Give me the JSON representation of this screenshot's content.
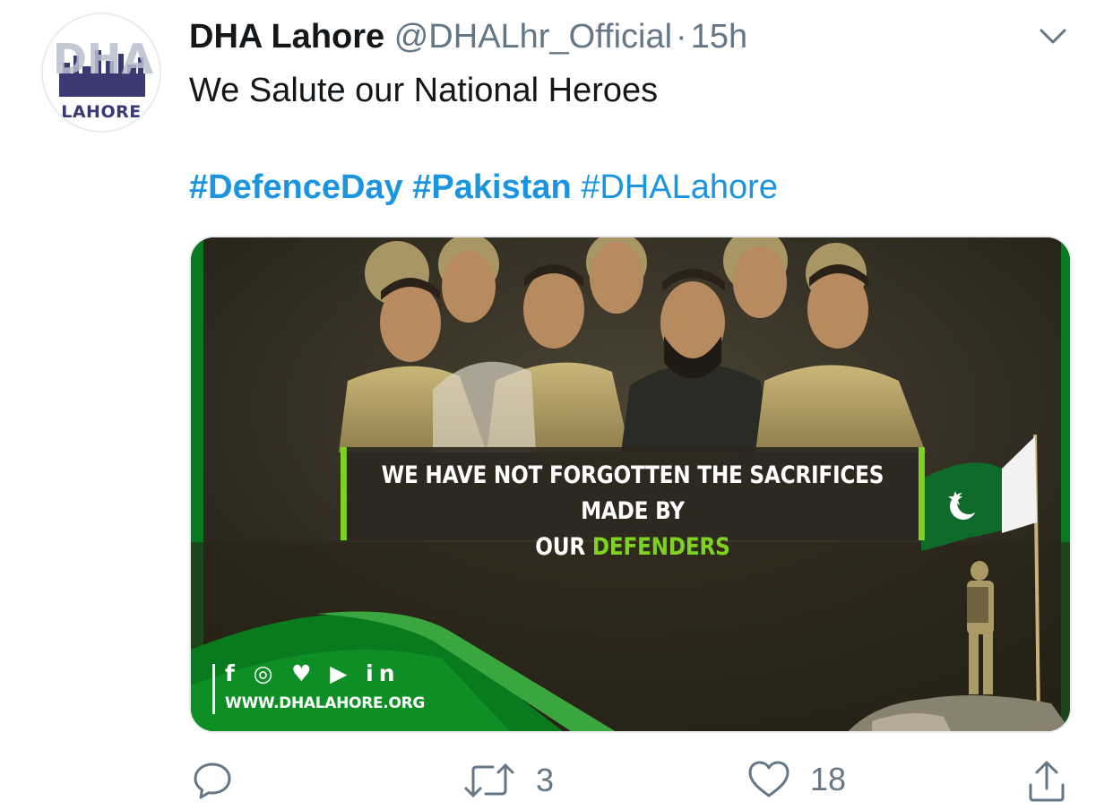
{
  "tweet": {
    "author_name": "DHA Lahore",
    "handle": "@DHALhr_Official",
    "separator": "·",
    "time": "15h",
    "text": "We Salute our National Heroes",
    "hashtags": [
      "#DefenceDay",
      "#Pakistan",
      "#DHALahore"
    ]
  },
  "avatar": {
    "logo_text": "DHA",
    "caption": "LAHORE"
  },
  "media": {
    "headline_line1": "WE HAVE NOT FORGOTTEN THE SACRIFICES MADE BY",
    "headline_line2_prefix": "OUR",
    "headline_line2_highlight": "DEFENDERS",
    "social_icons": "f ◎ ♥ ▶ in",
    "website": "WWW.DHALAHORE.ORG"
  },
  "actions": {
    "reply_count": "",
    "retweet_count": "3",
    "like_count": "18"
  },
  "icons": [
    "dha-logo-icon",
    "chevron-down-icon",
    "reply-icon",
    "retweet-icon",
    "like-icon",
    "share-icon",
    "pakistan-flag-icon"
  ],
  "colors": {
    "link": "#1b95e0",
    "muted": "#657786",
    "green": "#7ed321",
    "dark_green": "#0a7a1e",
    "logo_purple": "#3a3a72"
  }
}
